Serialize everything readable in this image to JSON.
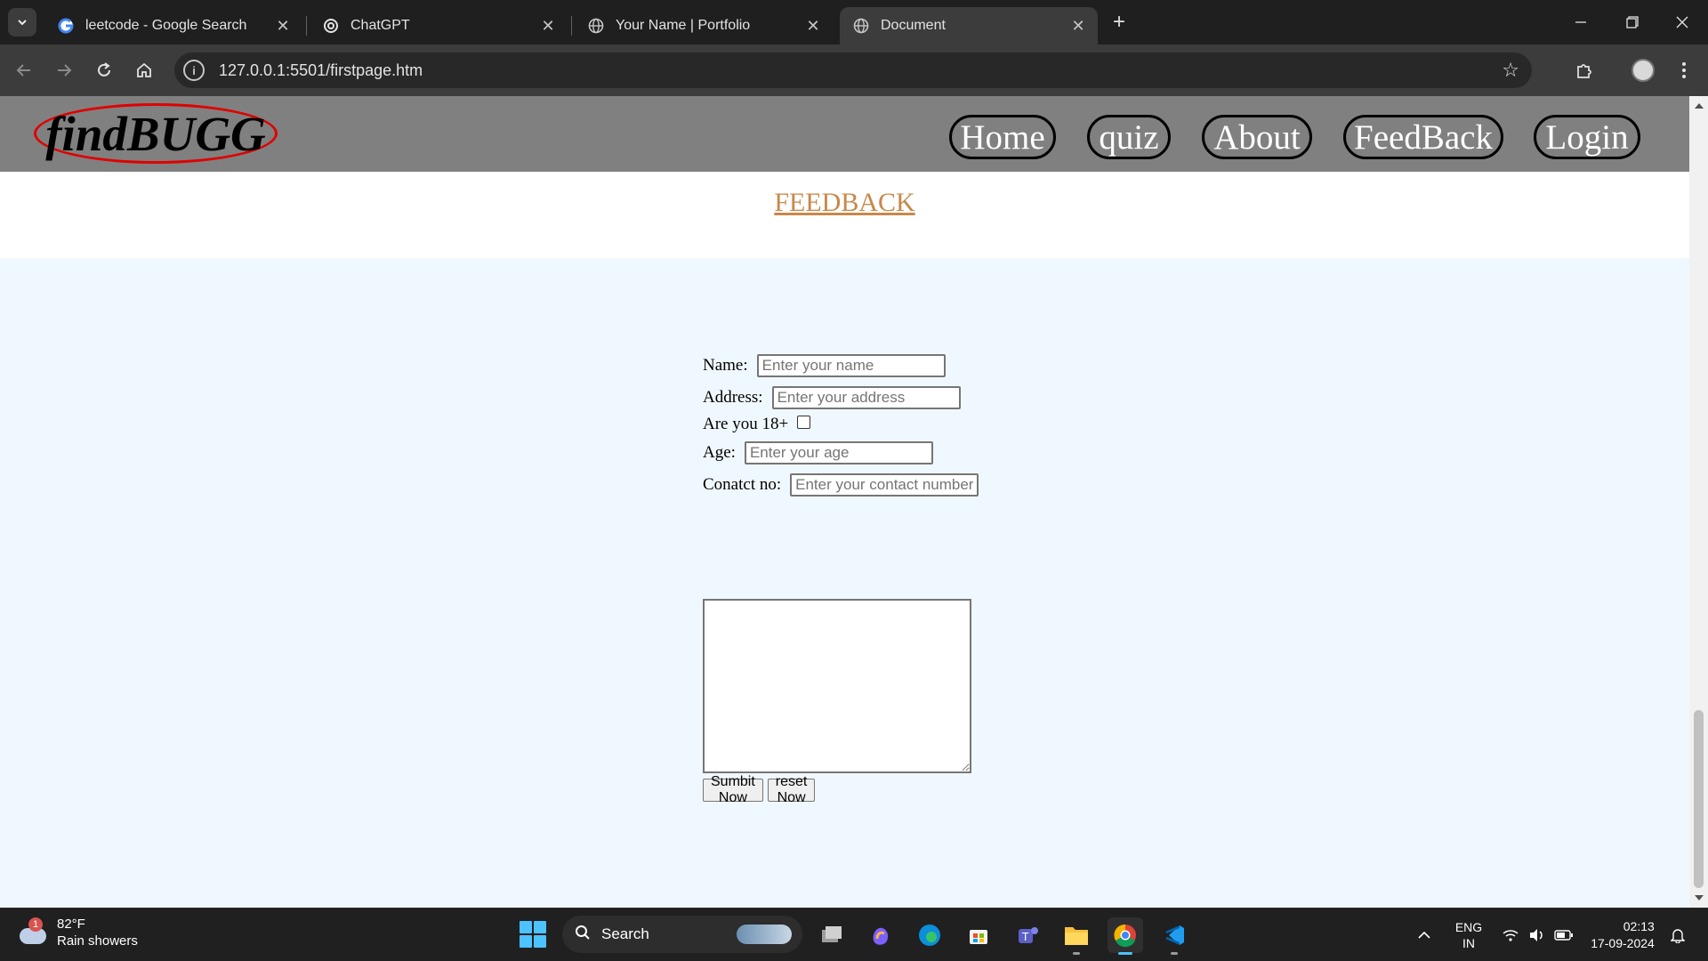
{
  "browser": {
    "tabs": [
      {
        "title": "leetcode - Google Search",
        "favicon": "google-icon"
      },
      {
        "title": "ChatGPT",
        "favicon": "chatgpt-icon"
      },
      {
        "title": "Your Name | Portfolio",
        "favicon": "globe-icon"
      },
      {
        "title": "Document",
        "favicon": "globe-icon",
        "active": true
      }
    ],
    "url": "127.0.0.1:5501/firstpage.htm"
  },
  "site": {
    "logo": "findBUGG",
    "nav": [
      "Home",
      "quiz",
      "About",
      "FeedBack",
      "Login"
    ],
    "page_title": "FEEDBACK",
    "form": {
      "name_label": "Name:",
      "name_placeholder": "Enter your name",
      "address_label": "Address:",
      "address_placeholder": "Enter your address",
      "adult_label": "Are you 18+",
      "adult_checked": false,
      "age_label": "Age:",
      "age_placeholder": "Enter your age",
      "contact_label": "Conatct no:",
      "contact_placeholder": "Enter your contact number",
      "submit_label": "Sumbit Now",
      "reset_label": "reset Now"
    }
  },
  "taskbar": {
    "weather_temp": "82°F",
    "weather_desc": "Rain showers",
    "weather_badge": "1",
    "search_label": "Search",
    "lang_1": "ENG",
    "lang_2": "IN",
    "time": "02:13",
    "date": "17-09-2024"
  },
  "colors": {
    "header_bg": "#808080",
    "page_bg": "#f0f8ff",
    "title_color": "#c8884a",
    "logo_ring": "#e00000"
  }
}
